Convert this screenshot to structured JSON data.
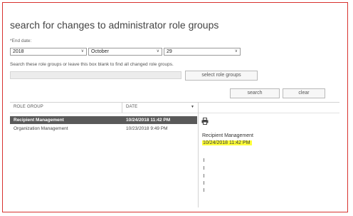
{
  "page": {
    "title": "search for changes to administrator role groups"
  },
  "end_date": {
    "label": "*End date:",
    "year": "2018",
    "month": "October",
    "day": "29",
    "chevron_icon": "chevron-down"
  },
  "role_groups": {
    "hint": "Search these role groups or leave this box blank to find all changed role groups.",
    "value": "",
    "select_button": "select role groups"
  },
  "actions": {
    "search": "search",
    "clear": "clear"
  },
  "table": {
    "headers": {
      "role_group": "ROLE GROUP",
      "date": "DATE"
    },
    "rows": [
      {
        "role_group": "Recipient Management",
        "date": "10/24/2018 11:42 PM",
        "selected": true
      },
      {
        "role_group": "Organization Management",
        "date": "10/23/2018 9:49 PM",
        "selected": false
      }
    ]
  },
  "details": {
    "print_icon": "printer-icon",
    "name": "Recipient Management",
    "date": "10/24/2018 11:42 PM",
    "highlight_color": "#ffff3a"
  },
  "colors": {
    "frame": "#d8322e",
    "selected_row": "#5a5a5a"
  }
}
